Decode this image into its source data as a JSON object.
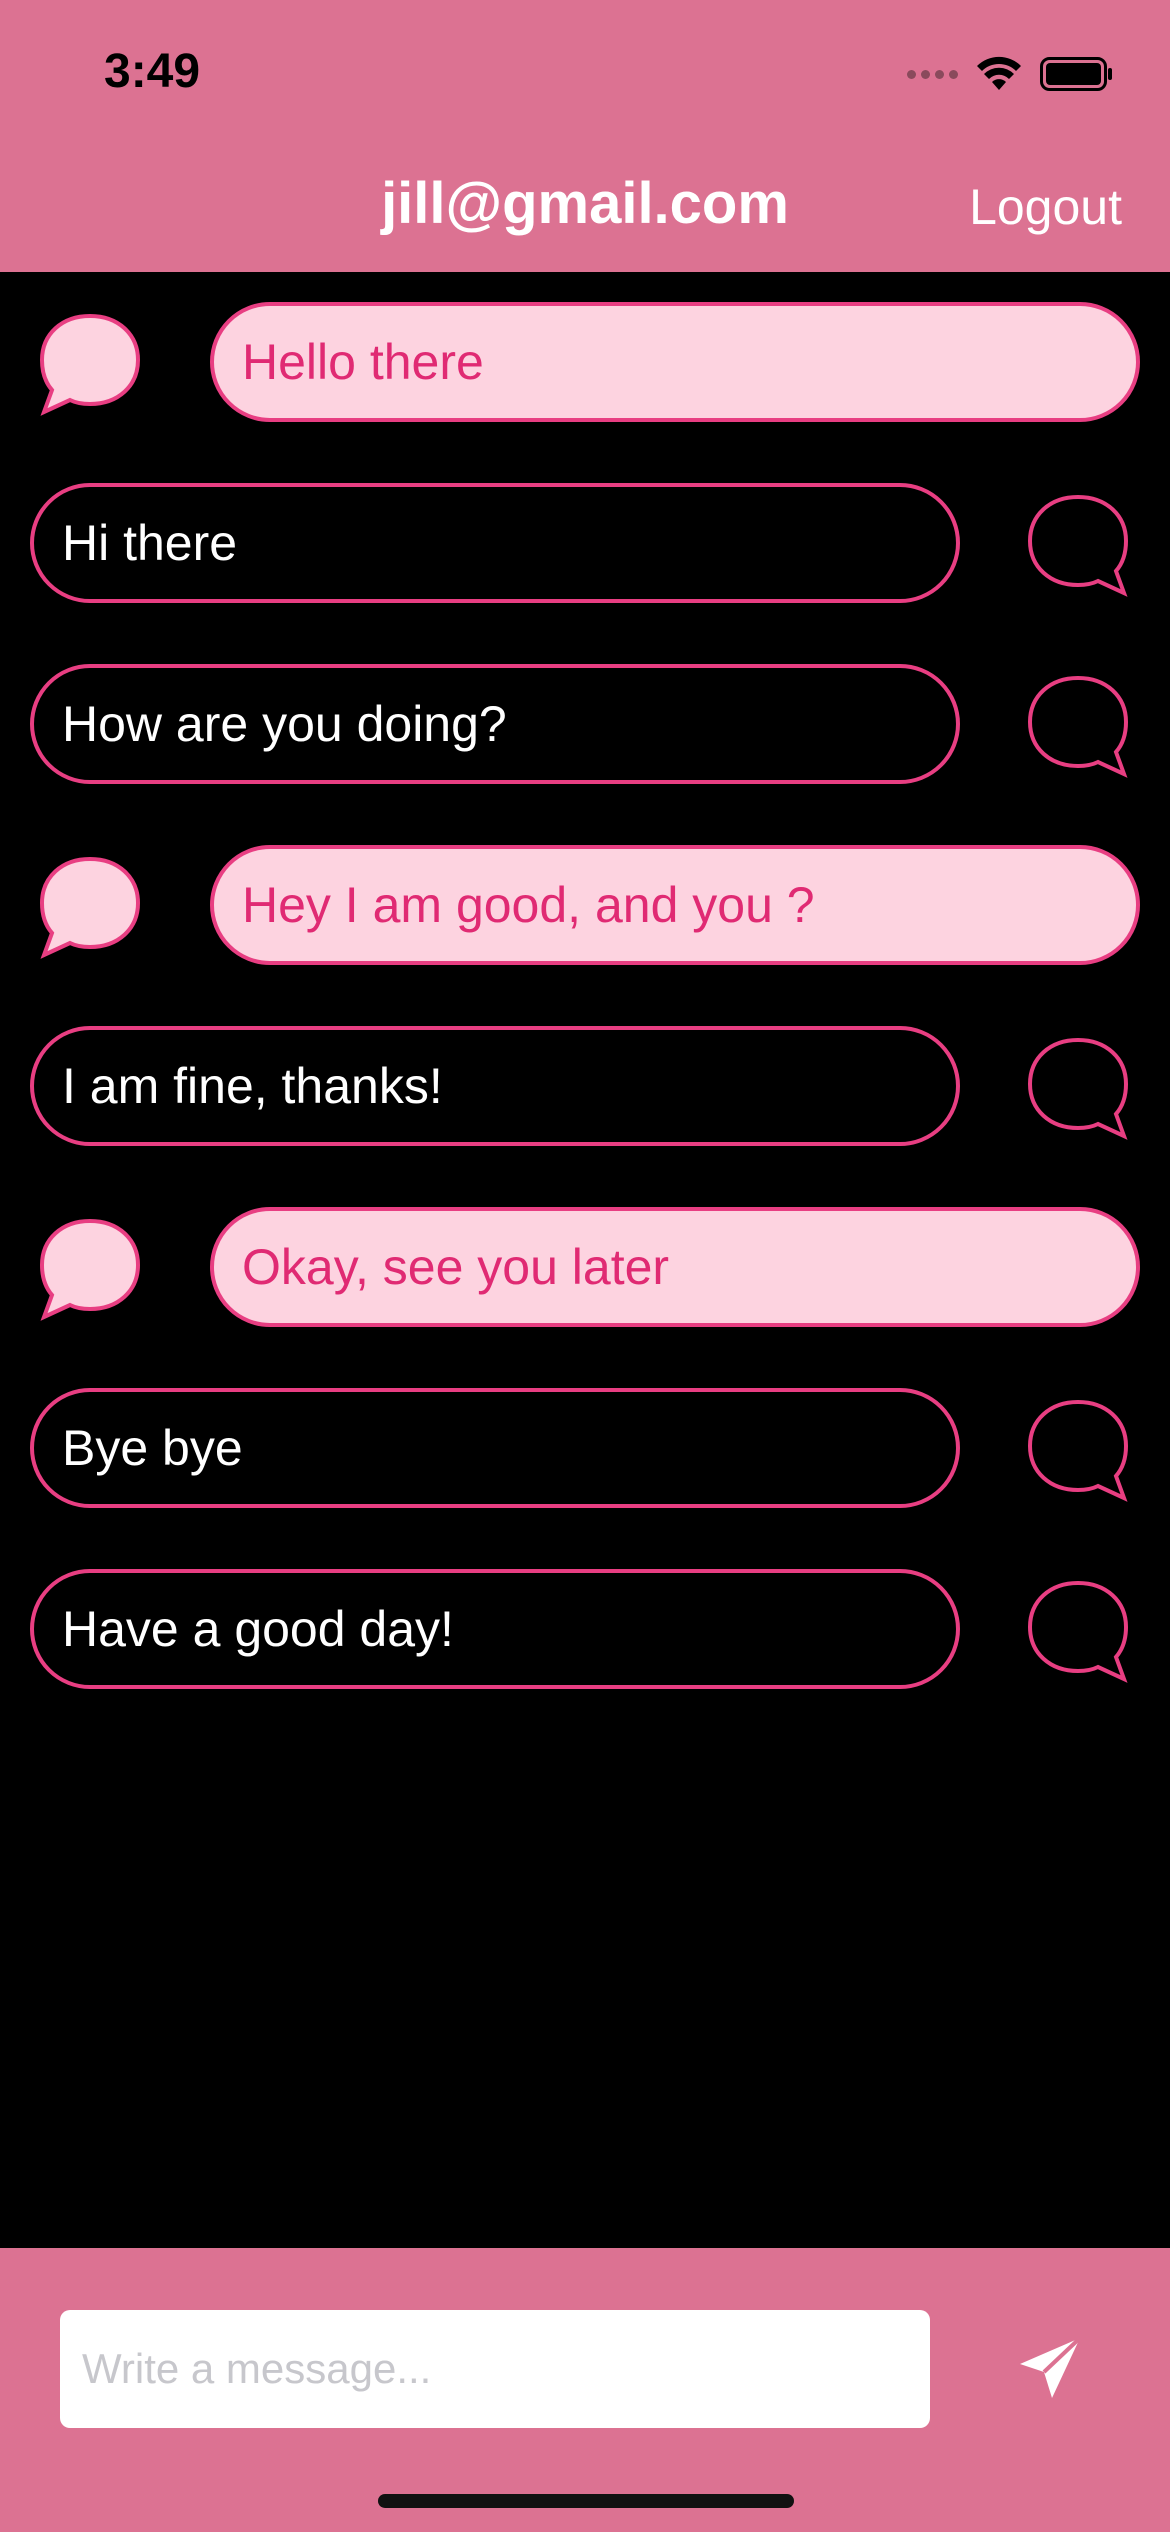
{
  "status_bar": {
    "time": "3:49"
  },
  "header": {
    "title": "jill@gmail.com",
    "logout_label": "Logout"
  },
  "messages": [
    {
      "text": "Hello there",
      "from": "other"
    },
    {
      "text": "Hi there",
      "from": "me"
    },
    {
      "text": "How are you doing?",
      "from": "me"
    },
    {
      "text": "Hey I am good, and you ?",
      "from": "other"
    },
    {
      "text": "I am fine, thanks!",
      "from": "me"
    },
    {
      "text": "Okay, see you later",
      "from": "other"
    },
    {
      "text": "Bye bye",
      "from": "me"
    },
    {
      "text": "Have a good day!",
      "from": "me"
    }
  ],
  "composer": {
    "placeholder": "Write a message...",
    "value": ""
  },
  "icons": {
    "incoming_avatar": "chat-bubble-filled-icon",
    "outgoing_avatar": "chat-bubble-outline-icon",
    "send": "paper-plane-icon"
  },
  "colors": {
    "header_bg": "#dc7292",
    "bubble_border": "#e83e82",
    "incoming_bg": "#fdd3e0",
    "incoming_text": "#e02a73",
    "outgoing_bg": "#000000",
    "outgoing_text": "#ffffff"
  }
}
